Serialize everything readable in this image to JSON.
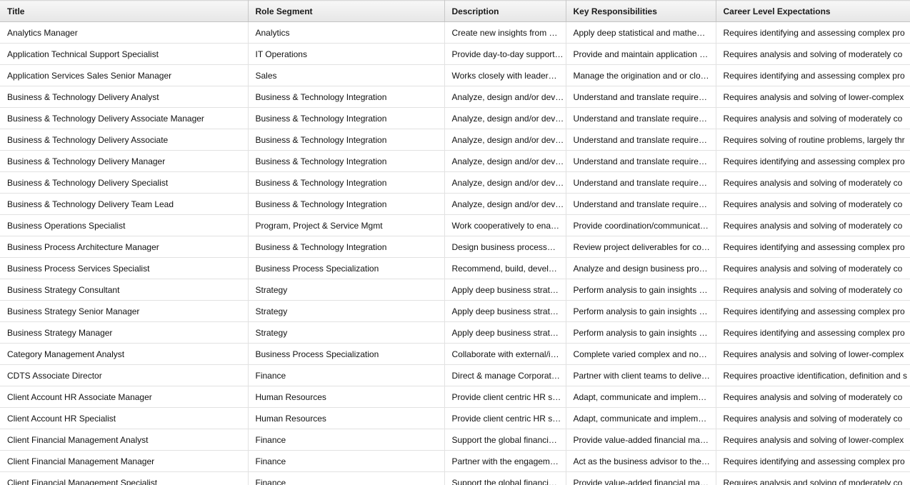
{
  "columns": [
    "Title",
    "Role Segment",
    "Description",
    "Key Responsibilities",
    "Career Level Expectations"
  ],
  "rows": [
    [
      "Analytics Manager",
      "Analytics",
      "Create new insights from …",
      "Apply deep statistical and mathe…",
      "Requires identifying and assessing complex pro"
    ],
    [
      "Application Technical Support Specialist",
      "IT Operations",
      "Provide day-to-day support…",
      "Provide and maintain application …",
      "Requires analysis and solving of moderately co"
    ],
    [
      "Application Services Sales Senior Manager",
      "Sales",
      "Works closely with leader…",
      "Manage the origination and or clo…",
      "Requires identifying and assessing complex pro"
    ],
    [
      "Business & Technology Delivery Analyst",
      "Business & Technology Integration",
      "Analyze, design and/or dev…",
      "Understand and translate require…",
      "Requires analysis and solving of lower-complex"
    ],
    [
      "Business & Technology Delivery Associate Manager",
      "Business & Technology Integration",
      "Analyze, design and/or dev…",
      "Understand and translate require…",
      "Requires analysis and solving of moderately co"
    ],
    [
      "Business & Technology Delivery Associate",
      "Business & Technology Integration",
      "Analyze, design and/or dev…",
      "Understand and translate require…",
      "Requires solving of routine problems, largely thr"
    ],
    [
      "Business & Technology Delivery Manager",
      "Business & Technology Integration",
      "Analyze, design and/or dev…",
      "Understand and translate require…",
      "Requires identifying and assessing complex pro"
    ],
    [
      "Business & Technology Delivery Specialist",
      "Business & Technology Integration",
      "Analyze, design and/or dev…",
      "Understand and translate require…",
      "Requires analysis and solving of moderately co"
    ],
    [
      "Business & Technology Delivery Team Lead",
      "Business & Technology Integration",
      "Analyze, design and/or dev…",
      "Understand and translate require…",
      "Requires analysis and solving of moderately co"
    ],
    [
      "Business Operations Specialist",
      "Program, Project & Service Mgmt",
      "Work cooperatively to ena…",
      "Provide coordination/communicat…",
      "Requires analysis and solving of moderately co"
    ],
    [
      "Business Process Architecture Manager",
      "Business & Technology Integration",
      "Design business process…",
      "Review project deliverables for co…",
      "Requires identifying and assessing complex pro"
    ],
    [
      "Business Process Services Specialist",
      "Business Process Specialization",
      "Recommend, build, devel…",
      "Analyze and design business pro…",
      "Requires analysis and solving of moderately co"
    ],
    [
      "Business Strategy Consultant",
      "Strategy",
      "Apply deep business strat…",
      "Perform analysis to gain insights …",
      "Requires analysis and solving of moderately co"
    ],
    [
      "Business Strategy Senior Manager",
      "Strategy",
      "Apply deep business strat…",
      "Perform analysis to gain insights …",
      "Requires identifying and assessing complex pro"
    ],
    [
      "Business Strategy Manager",
      "Strategy",
      "Apply deep business strat…",
      "Perform analysis to gain insights …",
      "Requires identifying and assessing complex pro"
    ],
    [
      "Category Management Analyst",
      "Business Process Specialization",
      "Collaborate with external/i…",
      "Complete varied complex and no…",
      "Requires analysis and solving of lower-complex"
    ],
    [
      "CDTS Associate Director",
      "Finance",
      "Direct & manage Corporat…",
      "Partner with client teams to delive…",
      "Requires proactive identification, definition and s"
    ],
    [
      "Client Account HR Associate Manager",
      "Human Resources",
      "Provide client centric HR s…",
      "Adapt, communicate and implem…",
      "Requires analysis and solving of moderately co"
    ],
    [
      "Client Account HR Specialist",
      "Human Resources",
      "Provide client centric HR s…",
      "Adapt, communicate and implem…",
      "Requires analysis and solving of moderately co"
    ],
    [
      "Client Financial Management Analyst",
      "Finance",
      "Support the global financi…",
      "Provide value-added financial ma…",
      "Requires analysis and solving of lower-complex"
    ],
    [
      "Client Financial Management Manager",
      "Finance",
      "Partner with the engagem…",
      "Act as the business advisor to the…",
      "Requires identifying and assessing complex pro"
    ],
    [
      "Client Financial Management Specialist",
      "Finance",
      "Support the global financi…",
      "Provide value-added financial ma…",
      "Requires analysis and solving of moderately co"
    ]
  ]
}
